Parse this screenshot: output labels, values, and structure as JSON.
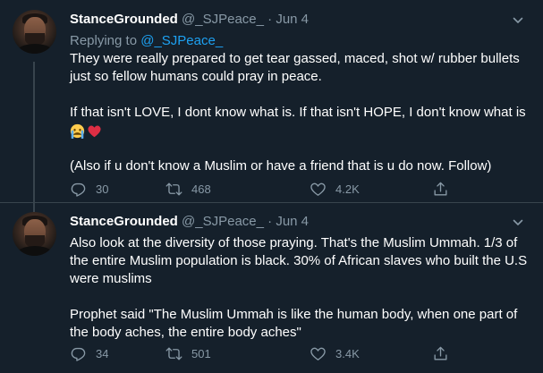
{
  "tweets": [
    {
      "author_name": "StanceGrounded",
      "handle": "@_SJPeace_",
      "dot": "·",
      "date": "Jun 4",
      "replying_prefix": "Replying to",
      "replying_to": "@_SJPeace_",
      "lines": [
        "They were really prepared to get tear gassed, maced, shot w/ rubber bullets just so fellow humans could pray in peace.",
        "If that isn't LOVE, I dont know what is. If that isn't HOPE, I don't know what is",
        "(Also if u don't know a Muslim or have a friend that is u do now. Follow)"
      ],
      "emojis": [
        "crying-face-emoji",
        "red-heart-emoji"
      ],
      "replies": "30",
      "retweets": "468",
      "likes": "4.2K"
    },
    {
      "author_name": "StanceGrounded",
      "handle": "@_SJPeace_",
      "dot": "·",
      "date": "Jun 4",
      "lines": [
        "Also look at the diversity of those praying. That's the Muslim Ummah. 1/3 of the entire Muslim population is black. 30% of African slaves who built the U.S were muslims",
        "Prophet said \"The Muslim Ummah is like the human body, when one part of the body aches, the entire body aches\""
      ],
      "replies": "34",
      "retweets": "501",
      "likes": "3.4K"
    }
  ],
  "colors": {
    "background": "#15202b",
    "secondary_text": "#8899a6",
    "link": "#1da1f2",
    "divider": "#38444d"
  }
}
